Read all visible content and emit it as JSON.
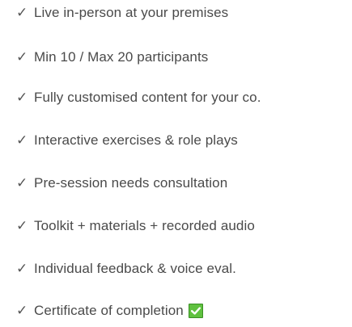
{
  "features": [
    {
      "check": "✓",
      "text": "Live in-person at your premises"
    },
    {
      "check": "✓",
      "text": "Min 10 / Max 20 participants"
    },
    {
      "check": "✓",
      "text": "Fully customised content for your co."
    },
    {
      "check": "✓",
      "text": "Interactive exercises & role plays"
    },
    {
      "check": "✓",
      "text": "Pre-session needs consultation"
    },
    {
      "check": "✓",
      "text": "Toolkit + materials + recorded audio"
    },
    {
      "check": "✓",
      "text": "Individual feedback & voice eval."
    },
    {
      "check": "✓",
      "text": "Certificate of completion",
      "badge": "white-check-on-green-icon"
    }
  ],
  "colors": {
    "text": "#4a4a4a",
    "badge_green": "#5fc13f"
  }
}
